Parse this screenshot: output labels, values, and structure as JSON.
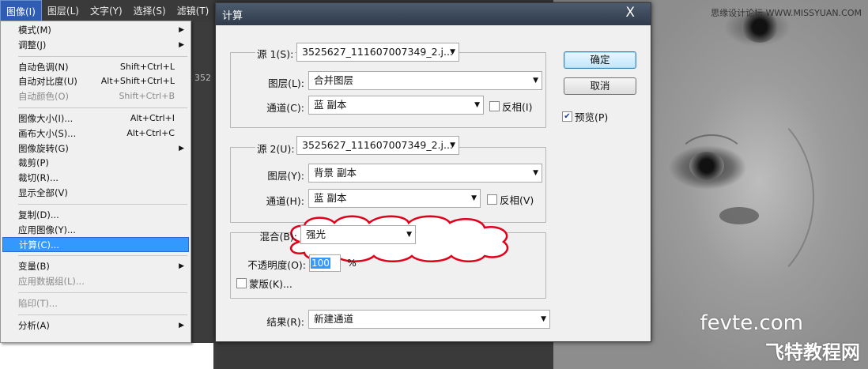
{
  "menubar": {
    "items": [
      "图像(I)",
      "图层(L)",
      "文字(Y)",
      "选择(S)",
      "滤镜(T)"
    ]
  },
  "app_strip": {
    "text": "352"
  },
  "image_menu": {
    "groups": [
      [
        {
          "label": "模式(M)",
          "shortcut": "",
          "submenu": true
        },
        {
          "label": "调整(J)",
          "shortcut": "",
          "submenu": true
        }
      ],
      [
        {
          "label": "自动色调(N)",
          "shortcut": "Shift+Ctrl+L"
        },
        {
          "label": "自动对比度(U)",
          "shortcut": "Alt+Shift+Ctrl+L"
        },
        {
          "label": "自动颜色(O)",
          "shortcut": "Shift+Ctrl+B",
          "disabled": true
        }
      ],
      [
        {
          "label": "图像大小(I)...",
          "shortcut": "Alt+Ctrl+I"
        },
        {
          "label": "画布大小(S)...",
          "shortcut": "Alt+Ctrl+C"
        },
        {
          "label": "图像旋转(G)",
          "shortcut": "",
          "submenu": true
        },
        {
          "label": "裁剪(P)",
          "shortcut": ""
        },
        {
          "label": "裁切(R)...",
          "shortcut": ""
        },
        {
          "label": "显示全部(V)",
          "shortcut": ""
        }
      ],
      [
        {
          "label": "复制(D)...",
          "shortcut": ""
        },
        {
          "label": "应用图像(Y)...",
          "shortcut": ""
        },
        {
          "label": "计算(C)...",
          "shortcut": "",
          "highlighted": true
        }
      ],
      [
        {
          "label": "变量(B)",
          "shortcut": "",
          "submenu": true
        },
        {
          "label": "应用数据组(L)...",
          "shortcut": "",
          "disabled": true
        }
      ],
      [
        {
          "label": "陷印(T)...",
          "shortcut": "",
          "disabled": true
        }
      ],
      [
        {
          "label": "分析(A)",
          "shortcut": "",
          "submenu": true
        }
      ]
    ]
  },
  "dialog": {
    "title": "计算",
    "close": "X",
    "source1": {
      "legend": "源 1(S):",
      "file": "3525627_111607007349_2.j...",
      "layer_label": "图层(L):",
      "layer_value": "合并图层",
      "channel_label": "通道(C):",
      "channel_value": "蓝 副本",
      "invert_label": "反相(I)"
    },
    "source2": {
      "legend": "源 2(U):",
      "file": "3525627_111607007349_2.j...",
      "layer_label": "图层(Y):",
      "layer_value": "背景 副本",
      "channel_label": "通道(H):",
      "channel_value": "蓝 副本",
      "invert_label": "反相(V)"
    },
    "blend": {
      "label": "混合(B):",
      "value": "强光",
      "opacity_label": "不透明度(O):",
      "opacity_value": "100",
      "opacity_unit": "%",
      "mask_label": "蒙版(K)..."
    },
    "result": {
      "label": "结果(R):",
      "value": "新建通道"
    },
    "ok_label": "确定",
    "cancel_label": "取消",
    "preview_label": "预览(P)",
    "preview_checked": true
  },
  "watermarks": {
    "site": "思缘设计论坛 WWW.MISSYUAN.COM",
    "fevte": "fevte.com",
    "cn": "飞特教程网"
  },
  "colors": {
    "menu_highlight": "#3399ff",
    "cloud_outline": "#e0001a"
  }
}
